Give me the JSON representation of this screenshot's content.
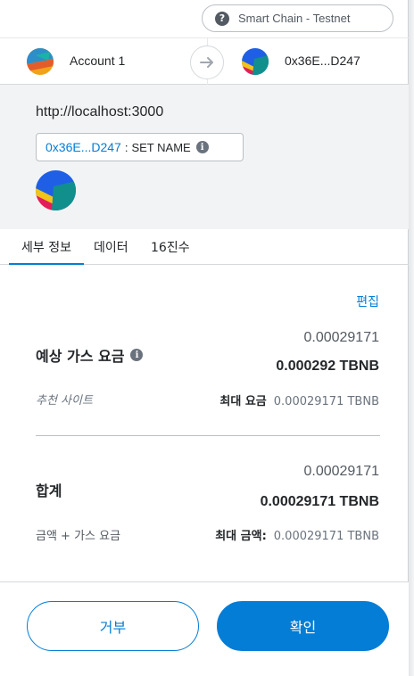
{
  "network": {
    "name": "Smart Chain - Testnet",
    "help_icon": "?"
  },
  "accounts": {
    "from_name": "Account 1",
    "to_name": "0x36E...D247"
  },
  "origin": {
    "url": "http://localhost:3000",
    "contract_address": "0x36E...D247",
    "separator": ":",
    "set_name_label": "SET NAME",
    "info_icon": "i"
  },
  "tabs": [
    {
      "label": "세부 정보"
    },
    {
      "label": "데이터"
    },
    {
      "label": "16진수"
    }
  ],
  "details": {
    "edit_label": "편집",
    "gas_label": "예상 가스 요금",
    "gas_fee_primary": "0.00029171",
    "gas_fee_value": "0.000292 TBNB",
    "recommended_label": "추천 사이트",
    "max_fee_label": "최대 요금",
    "max_fee_value": "0.00029171 TBNB",
    "total_label": "합계",
    "total_primary": "0.00029171",
    "total_value": "0.00029171 TBNB",
    "amount_plus_gas_label": "금액 + 가스 요금",
    "max_amount_label": "최대 금액:",
    "max_amount_value": "0.00029171 TBNB"
  },
  "footer": {
    "reject_label": "거부",
    "confirm_label": "확인"
  },
  "colors": {
    "accent": "#037dd6",
    "origin_bg": "#f2f3f4",
    "text": "#24272a",
    "muted": "#6a737d"
  }
}
